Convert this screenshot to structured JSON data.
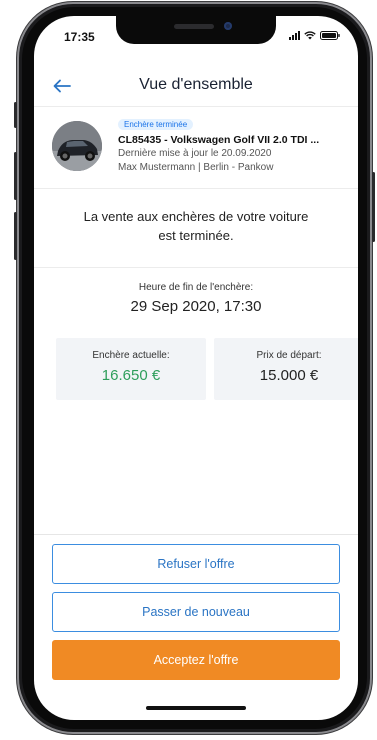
{
  "status_bar": {
    "time": "17:35"
  },
  "header": {
    "title": "Vue d'ensemble",
    "back_icon": "arrow-left-icon"
  },
  "car": {
    "badge": "Enchère terminée",
    "title": "CL85435 - Volkswagen Golf VII 2.0 TDI ...",
    "updated": "Dernière mise à jour le 20.09.2020",
    "seller": "Max Mustermann | Berlin - Pankow"
  },
  "message": "La vente aux enchères de votre voiture est terminée.",
  "auction_end": {
    "label": "Heure de fin de l'enchère:",
    "value": "29 Sep 2020, 17:30"
  },
  "prices": {
    "current_label": "Enchère actuelle:",
    "current_value": "16.650 €",
    "start_label": "Prix de départ:",
    "start_value": "15.000 €"
  },
  "actions": {
    "refuse": "Refuser l'offre",
    "relist": "Passer de nouveau",
    "accept": "Acceptez l'offre"
  },
  "colors": {
    "accent_blue": "#2a74c4",
    "accept_orange": "#f08a24",
    "price_green": "#2e9e5b",
    "badge_bg": "#e3f1ff"
  }
}
